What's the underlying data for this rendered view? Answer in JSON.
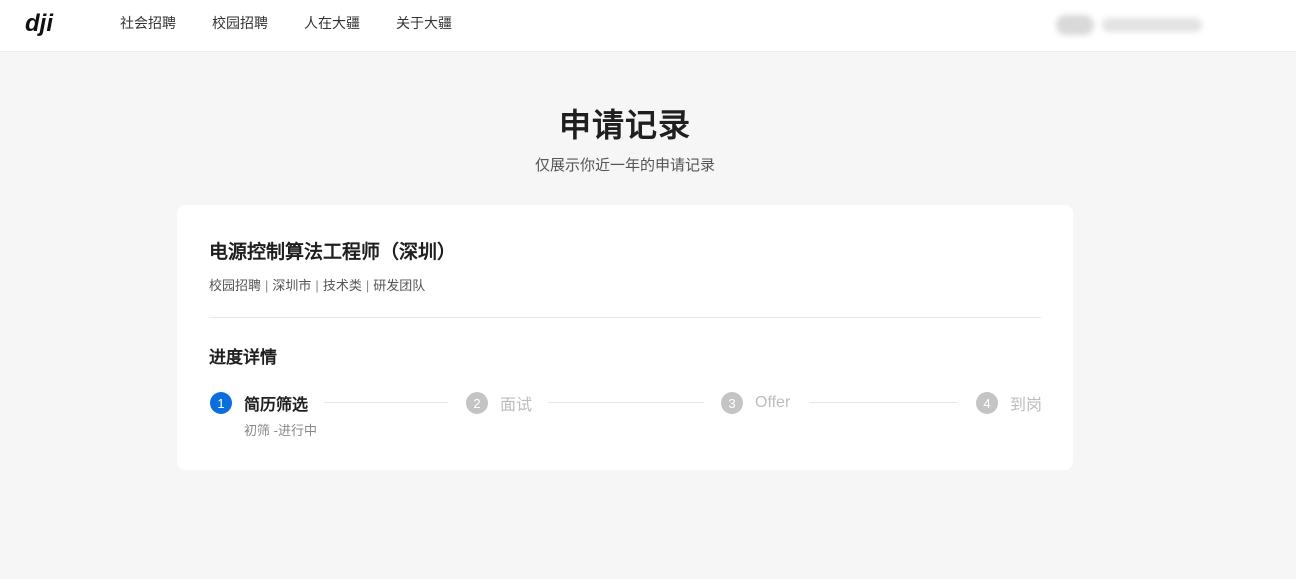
{
  "nav": {
    "logo_text": "dji",
    "links": [
      "社会招聘",
      "校园招聘",
      "人在大疆",
      "关于大疆"
    ]
  },
  "page": {
    "title": "申请记录",
    "subtitle": "仅展示你近一年的申请记录"
  },
  "application": {
    "job_title": "电源控制算法工程师（深圳）",
    "meta": [
      "校园招聘",
      "深圳市",
      "技术类",
      "研发团队"
    ],
    "meta_separator": "|",
    "progress_title": "进度详情",
    "steps": [
      {
        "num": "1",
        "label": "简历筛选",
        "active": true,
        "status": "初筛 -进行中"
      },
      {
        "num": "2",
        "label": "面试",
        "active": false
      },
      {
        "num": "3",
        "label": "Offer",
        "active": false
      },
      {
        "num": "4",
        "label": "到岗",
        "active": false
      }
    ]
  },
  "colors": {
    "accent": "#0a6fdc",
    "inactive": "#c4c4c4",
    "background": "#f6f6f6"
  }
}
